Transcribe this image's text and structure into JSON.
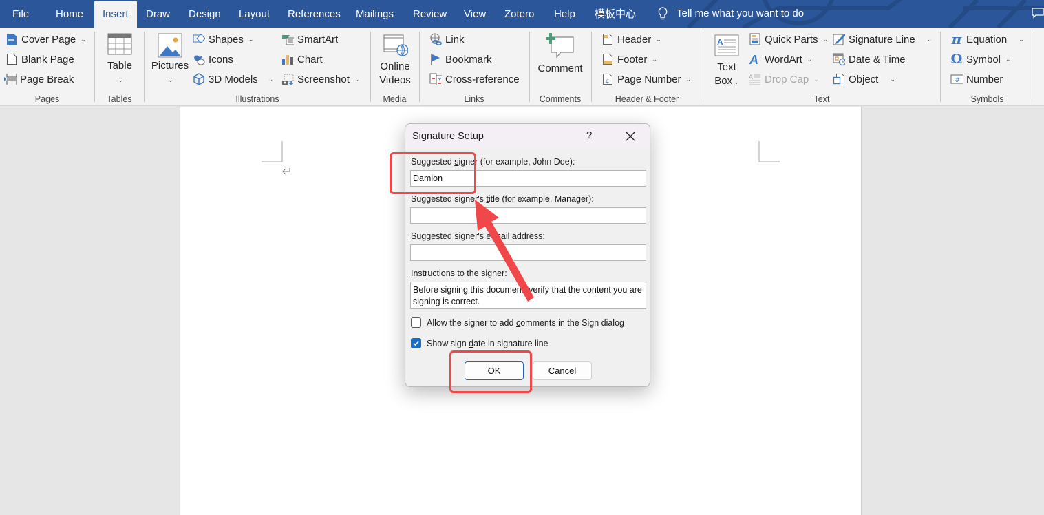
{
  "tabs": [
    {
      "label": "File",
      "active": false
    },
    {
      "label": "Home",
      "active": false
    },
    {
      "label": "Insert",
      "active": true
    },
    {
      "label": "Draw",
      "active": false
    },
    {
      "label": "Design",
      "active": false
    },
    {
      "label": "Layout",
      "active": false
    },
    {
      "label": "References",
      "active": false
    },
    {
      "label": "Mailings",
      "active": false
    },
    {
      "label": "Review",
      "active": false
    },
    {
      "label": "View",
      "active": false
    },
    {
      "label": "Zotero",
      "active": false
    },
    {
      "label": "Help",
      "active": false
    },
    {
      "label": "模板中心",
      "active": false
    }
  ],
  "tell_me": {
    "placeholder": "Tell me what you want to do",
    "icon": "lightbulb-icon"
  },
  "ribbon": {
    "groups": {
      "pages": {
        "label": "Pages",
        "items": {
          "cover_page": "Cover Page",
          "blank_page": "Blank Page",
          "page_break": "Page Break"
        }
      },
      "tables": {
        "label": "Tables",
        "items": {
          "table": "Table"
        }
      },
      "illustrations": {
        "label": "Illustrations",
        "items": {
          "pictures": "Pictures",
          "shapes": "Shapes",
          "icons": "Icons",
          "models_3d": "3D Models",
          "smartart": "SmartArt",
          "chart": "Chart",
          "screenshot": "Screenshot"
        }
      },
      "media": {
        "label": "Media",
        "items": {
          "online_videos_line1": "Online",
          "online_videos_line2": "Videos"
        }
      },
      "links": {
        "label": "Links",
        "items": {
          "link": "Link",
          "bookmark": "Bookmark",
          "cross_reference": "Cross-reference"
        }
      },
      "comments": {
        "label": "Comments",
        "items": {
          "comment": "Comment"
        }
      },
      "header_footer": {
        "label": "Header & Footer",
        "items": {
          "header": "Header",
          "footer": "Footer",
          "page_number": "Page Number"
        }
      },
      "text": {
        "label": "Text",
        "items": {
          "text_box_line1": "Text",
          "text_box_line2": "Box",
          "quick_parts": "Quick Parts",
          "wordart": "WordArt",
          "drop_cap": "Drop Cap",
          "signature_line": "Signature Line",
          "date_time": "Date & Time",
          "object": "Object"
        }
      },
      "symbols": {
        "label": "Symbols",
        "items": {
          "equation": "Equation",
          "symbol": "Symbol",
          "number": "Number"
        }
      }
    }
  },
  "dialog": {
    "title": "Signature Setup",
    "help": "?",
    "fields": {
      "signer_label_pre": "Suggested ",
      "signer_label_ul": "s",
      "signer_label_post": "igner (for example, John Doe):",
      "signer_value": "Damion",
      "title_label_pre": "Suggested signer's ",
      "title_label_ul": "t",
      "title_label_post": "itle (for example, Manager):",
      "title_value": "",
      "email_label_pre": "Suggested signer's ",
      "email_label_ul": "e",
      "email_label_post": "-mail address:",
      "email_value": "",
      "instructions_label_ul": "I",
      "instructions_label_post": "nstructions to the signer:",
      "instructions_value": "Before signing this document, verify that the content you are signing is correct."
    },
    "checkboxes": {
      "allow_comments": {
        "pre": "Allow the signer to add ",
        "ul": "c",
        "post": "omments in the Sign dialog",
        "checked": false
      },
      "show_date": {
        "pre": "Show sign ",
        "ul": "d",
        "post": "ate in signature line",
        "checked": true
      }
    },
    "buttons": {
      "ok": "OK",
      "cancel": "Cancel"
    }
  },
  "colors": {
    "brand": "#2b579a",
    "annotation": "#f0484a",
    "checkbox_accent": "#1a6dc2"
  }
}
